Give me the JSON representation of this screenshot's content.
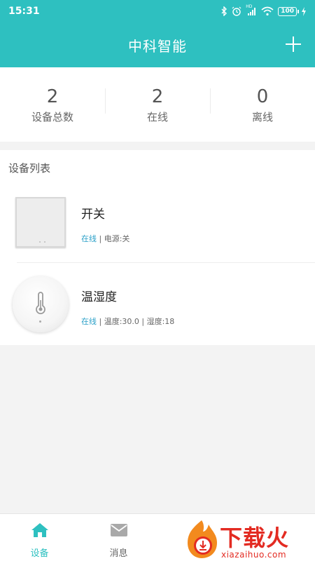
{
  "status_bar": {
    "time": "15:31",
    "network": "HD",
    "battery": "100"
  },
  "header": {
    "title": "中科智能"
  },
  "stats": [
    {
      "value": "2",
      "label": "设备总数"
    },
    {
      "value": "2",
      "label": "在线"
    },
    {
      "value": "0",
      "label": "离线"
    }
  ],
  "device_list": {
    "title": "设备列表",
    "devices": [
      {
        "name": "开关",
        "status": "在线",
        "detail": " | 电源:关"
      },
      {
        "name": "温湿度",
        "status": "在线",
        "detail": " | 温度:30.0 | 湿度:18"
      }
    ]
  },
  "tabs": [
    {
      "label": "设备",
      "icon": "home-icon",
      "active": true
    },
    {
      "label": "消息",
      "icon": "mail-icon",
      "active": false
    }
  ],
  "watermark": {
    "text": "下载火",
    "url": "xiazaihuo.com"
  },
  "colors": {
    "primary": "#2ec0c0",
    "online": "#2aa0c8",
    "watermark": "#e32b22"
  }
}
